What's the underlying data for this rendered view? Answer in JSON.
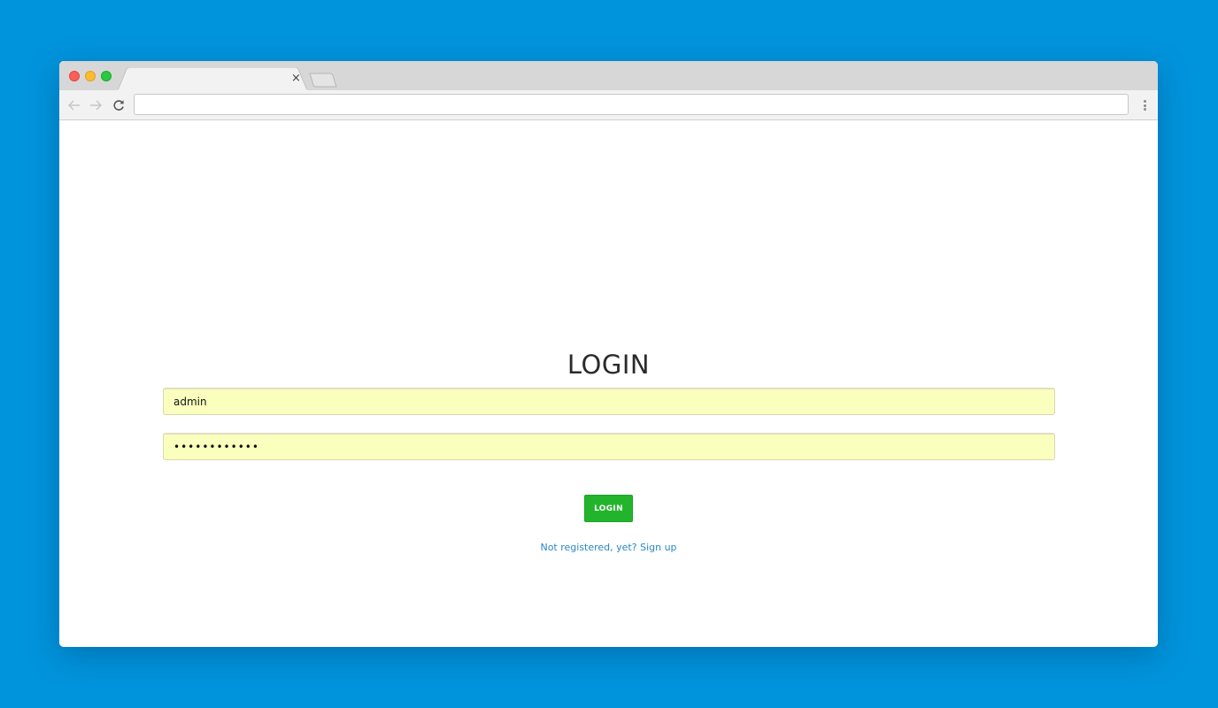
{
  "browser": {
    "tab": {
      "title": "",
      "close_glyph": "×"
    },
    "address_bar": {
      "value": ""
    }
  },
  "login": {
    "title": "LOGIN",
    "username_value": "admin",
    "password_value": "••••••••••••",
    "button_label": "LOGIN",
    "signup_text": "Not registered, yet? Sign up"
  },
  "colors": {
    "background": "#0094dc",
    "autofill_field": "#faffbd",
    "login_button": "#22b52c",
    "link": "#2a86c7"
  },
  "icons": {
    "back": "arrow-left-icon",
    "forward": "arrow-right-icon",
    "reload": "reload-icon",
    "menu": "kebab-menu-icon",
    "close_tab": "close-icon"
  }
}
